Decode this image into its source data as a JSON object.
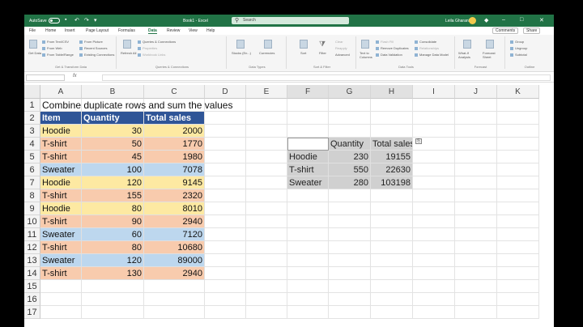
{
  "titlebar": {
    "autosave": "AutoSave",
    "toggle": "Off",
    "title": "Book1 - Excel",
    "search": "Search",
    "user": "Leila Gharani"
  },
  "ribbon_tabs": [
    "File",
    "Home",
    "Insert",
    "Page Layout",
    "Formulas",
    "Data",
    "Review",
    "View",
    "Help"
  ],
  "active_tab": "Data",
  "ribbon_right": {
    "comments": "Comments",
    "share": "Share"
  },
  "ribbon": {
    "get_data": "Get Data",
    "from_text": "From Text/CSV",
    "from_web": "From Web",
    "from_table": "From Table/Range",
    "from_picture": "From Picture",
    "recent_sources": "Recent Sources",
    "existing_connections": "Existing Connections",
    "group_get": "Get & Transform Data",
    "refresh_all": "Refresh All",
    "queries": "Queries & Connections",
    "properties": "Properties",
    "workbook_links": "Workbook Links",
    "group_queries": "Queries & Connections",
    "stocks": "Stocks (En...)",
    "currencies": "Currencies",
    "group_types": "Data Types",
    "sort": "Sort",
    "filter": "Filter",
    "clear": "Clear",
    "reapply": "Reapply",
    "advanced": "Advanced",
    "group_sort": "Sort & Filter",
    "text_to_columns": "Text to Columns",
    "flash_fill": "Flash Fill",
    "remove_duplicates": "Remove Duplicates",
    "data_validation": "Data Validation",
    "consolidate": "Consolidate",
    "relationships": "Relationships",
    "manage_model": "Manage Data Model",
    "group_tools": "Data Tools",
    "what_if": "What-If Analysis",
    "forecast_sheet": "Forecast Sheet",
    "group_forecast": "Forecast",
    "group": "Group",
    "ungroup": "Ungroup",
    "subtotal": "Subtotal",
    "group_outline": "Outline"
  },
  "formula_bar": {
    "name_box": "",
    "fx": "fx",
    "formula": ""
  },
  "columns": [
    "A",
    "B",
    "C",
    "D",
    "E",
    "F",
    "G",
    "H",
    "I",
    "J",
    "K"
  ],
  "rows": [
    "1",
    "2",
    "3",
    "4",
    "5",
    "6",
    "7",
    "8",
    "9",
    "10",
    "11",
    "12",
    "13",
    "14",
    "15",
    "16",
    "17"
  ],
  "sheet": {
    "title": "Combine duplicate rows and sum the values",
    "headers": [
      "Item",
      "Quantity",
      "Total sales"
    ],
    "data": [
      {
        "item": "Hoodie",
        "qty": "30",
        "sales": "2000",
        "kind": "hoodie"
      },
      {
        "item": "T-shirt",
        "qty": "50",
        "sales": "1770",
        "kind": "tshirt"
      },
      {
        "item": "T-shirt",
        "qty": "45",
        "sales": "1980",
        "kind": "tshirt"
      },
      {
        "item": "Sweater",
        "qty": "100",
        "sales": "7078",
        "kind": "sweater"
      },
      {
        "item": "Hoodie",
        "qty": "120",
        "sales": "9145",
        "kind": "hoodie"
      },
      {
        "item": "T-shirt",
        "qty": "155",
        "sales": "2320",
        "kind": "tshirt"
      },
      {
        "item": "Hoodie",
        "qty": "80",
        "sales": "8010",
        "kind": "hoodie"
      },
      {
        "item": "T-shirt",
        "qty": "90",
        "sales": "2940",
        "kind": "tshirt"
      },
      {
        "item": "Sweater",
        "qty": "60",
        "sales": "7120",
        "kind": "sweater"
      },
      {
        "item": "T-shirt",
        "qty": "80",
        "sales": "10680",
        "kind": "tshirt"
      },
      {
        "item": "Sweater",
        "qty": "120",
        "sales": "89000",
        "kind": "sweater"
      },
      {
        "item": "T-shirt",
        "qty": "130",
        "sales": "2940",
        "kind": "tshirt"
      }
    ],
    "consolidated_headers": [
      "",
      "Quantity",
      "Total sales"
    ],
    "consolidated": [
      {
        "item": "Hoodie",
        "qty": "230",
        "sales": "19155"
      },
      {
        "item": "T-shirt",
        "qty": "550",
        "sales": "22630"
      },
      {
        "item": "Sweater",
        "qty": "280",
        "sales": "103198"
      }
    ]
  },
  "colors": {
    "excel_green": "#217346",
    "header_blue": "#2f5597",
    "hoodie": "#fde9a2",
    "tshirt": "#f8cbad",
    "sweater": "#bdd7ee"
  }
}
